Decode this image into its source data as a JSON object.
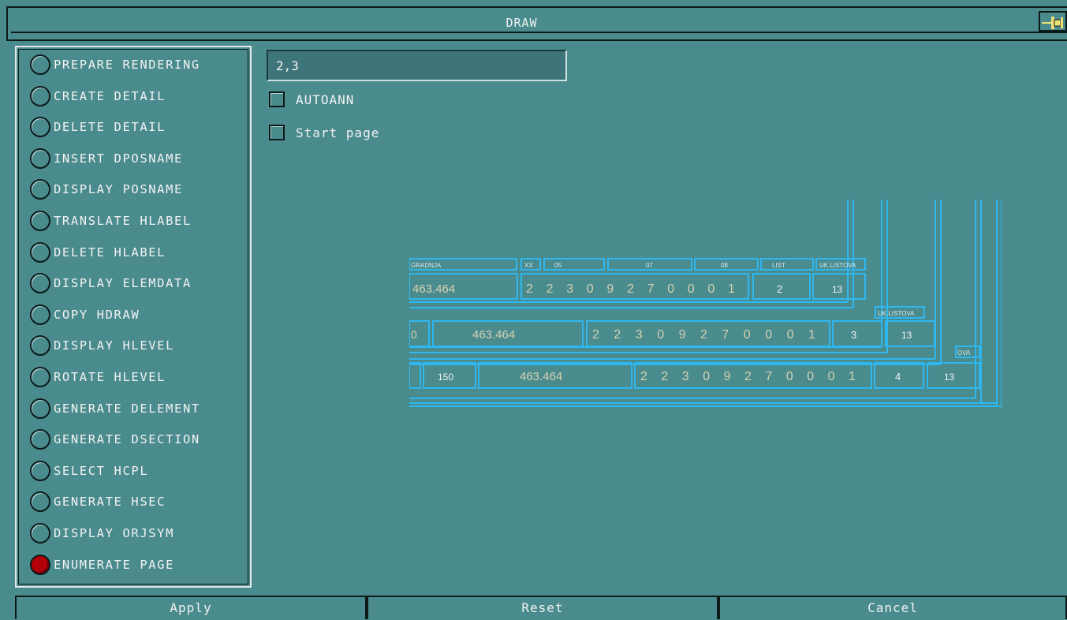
{
  "window": {
    "title": "DRAW"
  },
  "pin": {
    "icon": "pin-icon"
  },
  "options": [
    {
      "label": "PREPARE RENDERING",
      "selected": false
    },
    {
      "label": "CREATE DETAIL",
      "selected": false
    },
    {
      "label": "DELETE DETAIL",
      "selected": false
    },
    {
      "label": "INSERT DPOSNAME",
      "selected": false
    },
    {
      "label": "DISPLAY POSNAME",
      "selected": false
    },
    {
      "label": "TRANSLATE HLABEL",
      "selected": false
    },
    {
      "label": "DELETE HLABEL",
      "selected": false
    },
    {
      "label": "DISPLAY ELEMDATA",
      "selected": false
    },
    {
      "label": "COPY HDRAW",
      "selected": false
    },
    {
      "label": "DISPLAY HLEVEL",
      "selected": false
    },
    {
      "label": "ROTATE HLEVEL",
      "selected": false
    },
    {
      "label": "GENERATE DELEMENT",
      "selected": false
    },
    {
      "label": "GENERATE DSECTION",
      "selected": false
    },
    {
      "label": "SELECT HCPL",
      "selected": false
    },
    {
      "label": "GENERATE HSEC",
      "selected": false
    },
    {
      "label": "DISPLAY ORJSYM",
      "selected": false
    },
    {
      "label": "ENUMERATE PAGE",
      "selected": true
    }
  ],
  "page_field": {
    "value": "2,3"
  },
  "checkboxes": {
    "autoann": {
      "label": "AUTOANN",
      "checked": false
    },
    "start_page": {
      "label": "Start page",
      "checked": false
    }
  },
  "preview": {
    "row1": {
      "headers": [
        "GRADNJA",
        "XX",
        "05",
        "07",
        "08",
        "LIST",
        "UK.LISTOVA"
      ],
      "code": "463.464",
      "digits": [
        "2",
        "2",
        "3",
        "0",
        "9",
        "2",
        "7",
        "0",
        "0",
        "0",
        "1"
      ],
      "sheet": "2",
      "total": "13"
    },
    "row2": {
      "header": "UK.LISTOVA",
      "lead": "0",
      "code": "463.464",
      "digits": [
        "2",
        "2",
        "3",
        "0",
        "9",
        "2",
        "7",
        "0",
        "0",
        "0",
        "1"
      ],
      "sheet": "3",
      "total": "13"
    },
    "row3": {
      "header": "OVA",
      "num": "150",
      "code": "463.464",
      "digits": [
        "2",
        "2",
        "3",
        "0",
        "9",
        "2",
        "7",
        "0",
        "0",
        "0",
        "1"
      ],
      "sheet": "4",
      "total": "13"
    }
  },
  "buttons": {
    "apply": "Apply",
    "reset": "Reset",
    "cancel": "Cancel"
  },
  "colors": {
    "background": "#4a8b8e",
    "drawing_line": "#2fb7f0",
    "selected_radio": "#b30008"
  }
}
